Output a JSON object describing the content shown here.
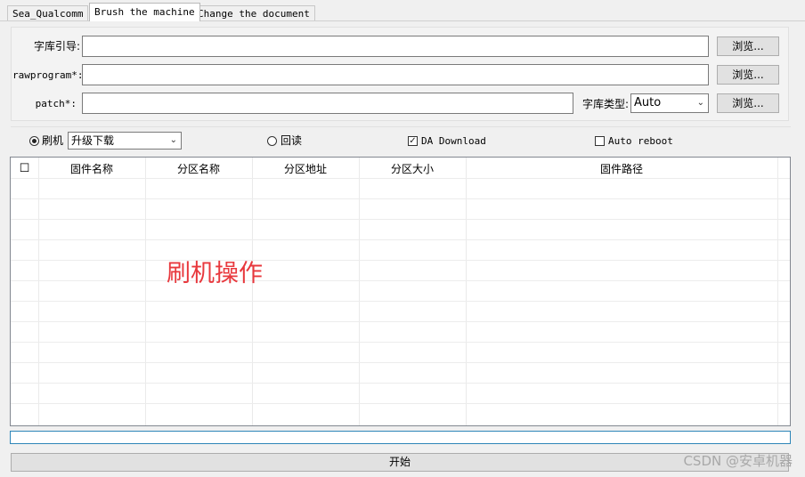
{
  "tabs": [
    {
      "label": "Sea_Qualcomm",
      "active": false
    },
    {
      "label": "Brush the machine",
      "active": true
    },
    {
      "label": "Change the document",
      "active": false
    }
  ],
  "form": {
    "font_guide_label": "字库引导:",
    "rawprogram_label": "rawprogram*:",
    "patch_label": "patch*:",
    "font_guide_value": "",
    "rawprogram_value": "",
    "patch_value": "",
    "browse_label": "浏览...",
    "font_type_label": "字库类型:",
    "font_type_value": "Auto"
  },
  "options": {
    "flash_label": "刷机",
    "flash_selected": true,
    "mode_value": "升级下载",
    "readback_label": "回读",
    "readback_selected": false,
    "da_download_label": "DA Download",
    "da_download_checked": true,
    "auto_reboot_label": "Auto reboot",
    "auto_reboot_checked": false
  },
  "table": {
    "select_all": "☐",
    "columns": [
      "固件名称",
      "分区名称",
      "分区地址",
      "分区大小",
      "固件路径"
    ],
    "rows": []
  },
  "overlay_text": "刷机操作",
  "progress": 0,
  "start_label": "开始",
  "watermark": "CSDN @安卓机器",
  "colors": {
    "overlay": "#e8383d",
    "progress_border": "#2e86b8"
  }
}
